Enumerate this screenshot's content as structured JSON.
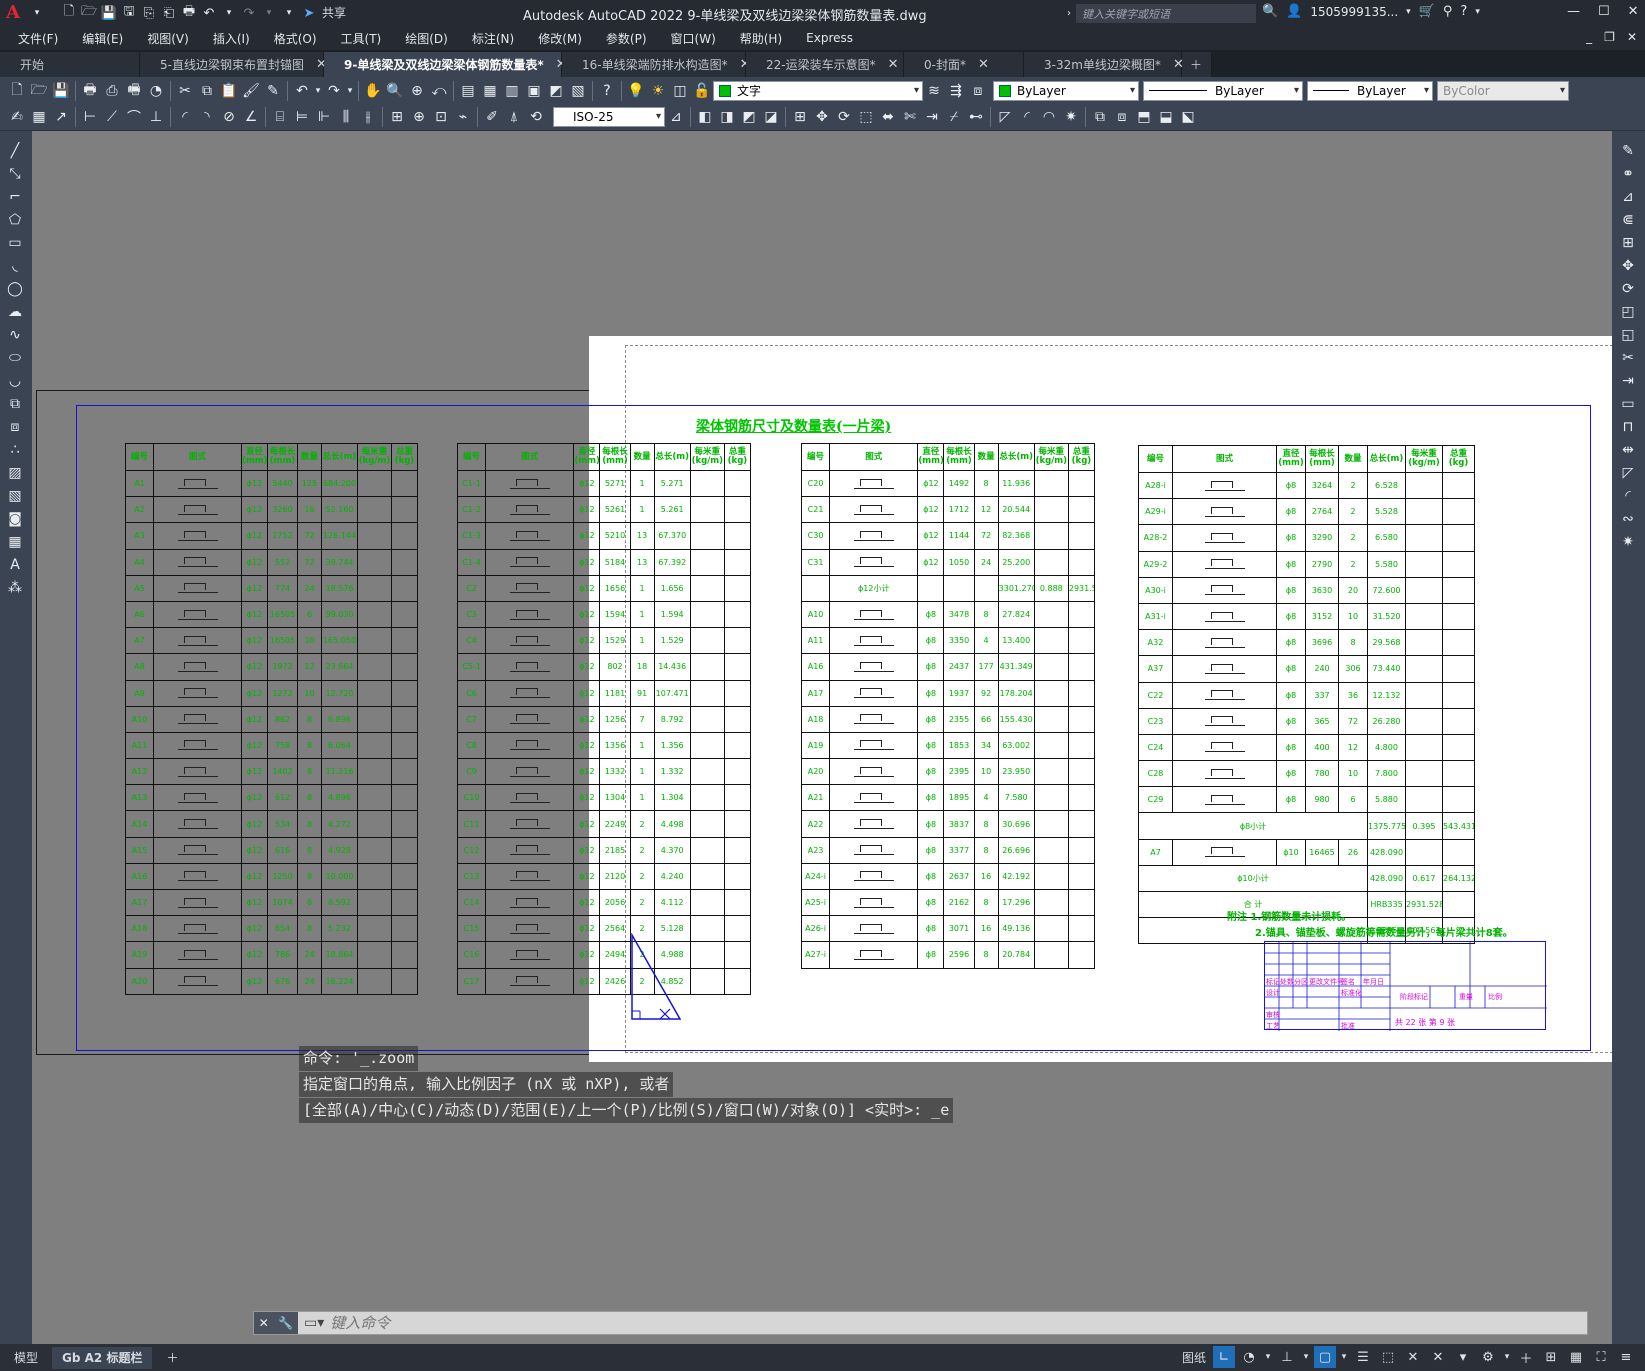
{
  "app": {
    "title": "Autodesk AutoCAD 2022   9-单线梁及双线边梁梁体钢筋数量表.dwg",
    "share": "共享",
    "search_placeholder": "键入关键字或短语",
    "user": "1505999135...",
    "logo": "A"
  },
  "menu": [
    "文件(F)",
    "编辑(E)",
    "视图(V)",
    "插入(I)",
    "格式(O)",
    "工具(T)",
    "绘图(D)",
    "标注(N)",
    "修改(M)",
    "参数(P)",
    "窗口(W)",
    "帮助(H)",
    "Express"
  ],
  "tabs": [
    {
      "label": "开始",
      "active": false
    },
    {
      "label": "5-直线边梁钢束布置封锚图",
      "active": false
    },
    {
      "label": "9-单线梁及双线边梁梁体钢筋数量表*",
      "active": true
    },
    {
      "label": "16-单线梁端防排水构造图*",
      "active": false
    },
    {
      "label": "22-运梁装车示意图*",
      "active": false
    },
    {
      "label": "0-封面*",
      "active": false
    },
    {
      "label": "3-32m单线边梁概图*",
      "active": false
    }
  ],
  "toolbar": {
    "textstyle": "文字",
    "layer_color": "ByLayer",
    "linetype": "ByLayer",
    "lineweight": "ByLayer",
    "plotstyle": "ByColor",
    "dimstyle": "ISO-25"
  },
  "drawing": {
    "title": "梁体钢筋尺寸及数量表(一片梁)",
    "headers": [
      "编号",
      "图式",
      "直径(mm)",
      "每根长(mm)",
      "数量",
      "总长(m)",
      "每米重(kg/m)",
      "总重(kg)"
    ],
    "t1": [
      [
        "A1",
        "ɸ12",
        "5440",
        "125",
        "684.200"
      ],
      [
        "A2",
        "ɸ12",
        "3260",
        "16",
        "52.160"
      ],
      [
        "A3",
        "ɸ12",
        "1752",
        "72",
        "126.144"
      ],
      [
        "A4",
        "ɸ12",
        "552",
        "72",
        "39.744"
      ],
      [
        "A5",
        "ɸ12",
        "774",
        "24",
        "18.576"
      ],
      [
        "A6",
        "ɸ12",
        "16505",
        "6",
        "99.030"
      ],
      [
        "A7",
        "ɸ12",
        "16505",
        "10",
        "165.050"
      ],
      [
        "A8",
        "ɸ12",
        "1972",
        "12",
        "23.664"
      ],
      [
        "A9",
        "ɸ12",
        "1272",
        "10",
        "12.720"
      ],
      [
        "A10",
        "ɸ12",
        "862",
        "8",
        "6.896"
      ],
      [
        "A11",
        "ɸ12",
        "758",
        "8",
        "6.064"
      ],
      [
        "A12",
        "ɸ12",
        "1402",
        "8",
        "11.216"
      ],
      [
        "A13",
        "ɸ12",
        "612",
        "8",
        "4.896"
      ],
      [
        "A14",
        "ɸ12",
        "534",
        "8",
        "4.272"
      ],
      [
        "A15",
        "ɸ12",
        "616",
        "8",
        "4.928"
      ],
      [
        "A16",
        "ɸ12",
        "1250",
        "8",
        "10.000"
      ],
      [
        "A17",
        "ɸ12",
        "1074",
        "8",
        "8.592"
      ],
      [
        "A18",
        "ɸ12",
        "654",
        "8",
        "5.232"
      ],
      [
        "A19",
        "ɸ12",
        "786",
        "24",
        "18.864"
      ],
      [
        "A20",
        "ɸ12",
        "676",
        "24",
        "16.224"
      ]
    ],
    "t2": [
      [
        "C1-1",
        "ɸ12",
        "5271",
        "1",
        "5.271"
      ],
      [
        "C1-2",
        "ɸ12",
        "5261",
        "1",
        "5.261"
      ],
      [
        "C1-3",
        "ɸ12",
        "5210",
        "13",
        "67.370"
      ],
      [
        "C1-4",
        "ɸ12",
        "5184",
        "13",
        "67.392"
      ],
      [
        "C2",
        "ɸ12",
        "1656",
        "1",
        "1.656"
      ],
      [
        "C3",
        "ɸ12",
        "1594",
        "1",
        "1.594"
      ],
      [
        "C4",
        "ɸ12",
        "1529",
        "1",
        "1.529"
      ],
      [
        "C5-1",
        "ɸ12",
        "802",
        "18",
        "14.436"
      ],
      [
        "C6",
        "ɸ12",
        "1181",
        "91",
        "107.471"
      ],
      [
        "C7",
        "ɸ12",
        "1256",
        "7",
        "8.792"
      ],
      [
        "C8",
        "ɸ12",
        "1356",
        "1",
        "1.356"
      ],
      [
        "C9",
        "ɸ12",
        "1332",
        "1",
        "1.332"
      ],
      [
        "C10",
        "ɸ12",
        "1304",
        "1",
        "1.304"
      ],
      [
        "C11",
        "ɸ12",
        "2249",
        "2",
        "4.498"
      ],
      [
        "C12",
        "ɸ12",
        "2185",
        "2",
        "4.370"
      ],
      [
        "C13",
        "ɸ12",
        "2120",
        "2",
        "4.240"
      ],
      [
        "C14",
        "ɸ12",
        "2056",
        "2",
        "4.112"
      ],
      [
        "C15",
        "ɸ12",
        "2564",
        "2",
        "5.128"
      ],
      [
        "C16",
        "ɸ12",
        "2494",
        "2",
        "4.988"
      ],
      [
        "C17",
        "ɸ12",
        "2426",
        "2",
        "4.852"
      ]
    ],
    "t3": [
      [
        "C20",
        "ɸ12",
        "1492",
        "8",
        "11.936"
      ],
      [
        "C21",
        "ɸ12",
        "1712",
        "12",
        "20.544"
      ],
      [
        "C30",
        "ɸ12",
        "1144",
        "72",
        "82.368"
      ],
      [
        "C31",
        "ɸ12",
        "1050",
        "24",
        "25.200"
      ],
      [
        "ɸ12小计",
        "",
        "",
        "",
        "3301.270"
      ],
      [
        "A10",
        "ɸ8",
        "3478",
        "8",
        "27.824"
      ],
      [
        "A11",
        "ɸ8",
        "3350",
        "4",
        "13.400"
      ],
      [
        "A16",
        "ɸ8",
        "2437",
        "177",
        "431.349"
      ],
      [
        "A17",
        "ɸ8",
        "1937",
        "92",
        "178.204"
      ],
      [
        "A18",
        "ɸ8",
        "2355",
        "66",
        "155.430"
      ],
      [
        "A19",
        "ɸ8",
        "1853",
        "34",
        "63.002"
      ],
      [
        "A20",
        "ɸ8",
        "2395",
        "10",
        "23.950"
      ],
      [
        "A21",
        "ɸ8",
        "1895",
        "4",
        "7.580"
      ],
      [
        "A22",
        "ɸ8",
        "3837",
        "8",
        "30.696"
      ],
      [
        "A23",
        "ɸ8",
        "3377",
        "8",
        "26.696"
      ],
      [
        "A24-i",
        "ɸ8",
        "2637",
        "16",
        "42.192"
      ],
      [
        "A25-i",
        "ɸ8",
        "2162",
        "8",
        "17.296"
      ],
      [
        "A26-i",
        "ɸ8",
        "3071",
        "16",
        "49.136"
      ],
      [
        "A27-i",
        "ɸ8",
        "2596",
        "8",
        "20.784"
      ]
    ],
    "t3_extra": {
      "unitweight": "0.888",
      "totalweight": "2931.526"
    },
    "t4": [
      [
        "A28-i",
        "ɸ8",
        "3264",
        "2",
        "6.528"
      ],
      [
        "A29-i",
        "ɸ8",
        "2764",
        "2",
        "5.528"
      ],
      [
        "A28-2",
        "ɸ8",
        "3290",
        "2",
        "6.580"
      ],
      [
        "A29-2",
        "ɸ8",
        "2790",
        "2",
        "5.580"
      ],
      [
        "A30-i",
        "ɸ8",
        "3630",
        "20",
        "72.600"
      ],
      [
        "A31-i",
        "ɸ8",
        "3152",
        "10",
        "31.520"
      ],
      [
        "A32",
        "ɸ8",
        "3696",
        "8",
        "29.568"
      ],
      [
        "A37",
        "ɸ8",
        "240",
        "306",
        "73.440"
      ],
      [
        "C22",
        "ɸ8",
        "337",
        "36",
        "12.132"
      ],
      [
        "C23",
        "ɸ8",
        "365",
        "72",
        "26.280"
      ],
      [
        "C24",
        "ɸ8",
        "400",
        "12",
        "4.800"
      ],
      [
        "C28",
        "ɸ8",
        "780",
        "10",
        "7.800"
      ],
      [
        "C29",
        "ɸ8",
        "980",
        "6",
        "5.880"
      ]
    ],
    "t4_sum": [
      [
        "ɸ8小计",
        "",
        "",
        "",
        "1375.775",
        "0.395",
        "543.431"
      ],
      [
        "A7",
        "ɸ10",
        "16465",
        "26",
        "428.090",
        "",
        ""
      ],
      [
        "ɸ10小计",
        "",
        "",
        "",
        "428.090",
        "0.617",
        "264.132"
      ],
      [
        "合 计",
        "",
        "",
        "",
        "HRB335",
        "2931.528",
        ""
      ],
      [
        "",
        "",
        "",
        "",
        "Q235",
        "807.563",
        ""
      ]
    ],
    "notes": [
      "附注  1.钢筋数量未计损耗。",
      "2.锚具、锚垫板、螺旋筋等需数量另计，每片梁共计8套。"
    ],
    "titleblock": {
      "page": "共 22 张  第 9 张",
      "labels": [
        "标记",
        "处数",
        "分区",
        "更改文件号",
        "签名",
        "年月日",
        "设计",
        "标准化",
        "审核",
        "工艺",
        "批准",
        "阶段标记",
        "重量",
        "比例"
      ]
    }
  },
  "command": {
    "history": [
      "命令: '_.zoom",
      "指定窗口的角点, 输入比例因子 (nX 或 nXP), 或者",
      "[全部(A)/中心(C)/动态(D)/范围(E)/上一个(P)/比例(S)/窗口(W)/对象(O)] <实时>: _e"
    ],
    "placeholder": "键入命令"
  },
  "layouts": [
    {
      "label": "模型",
      "active": false
    },
    {
      "label": "Gb A2 标题栏",
      "active": true
    }
  ],
  "status": {
    "paper": "图纸"
  }
}
